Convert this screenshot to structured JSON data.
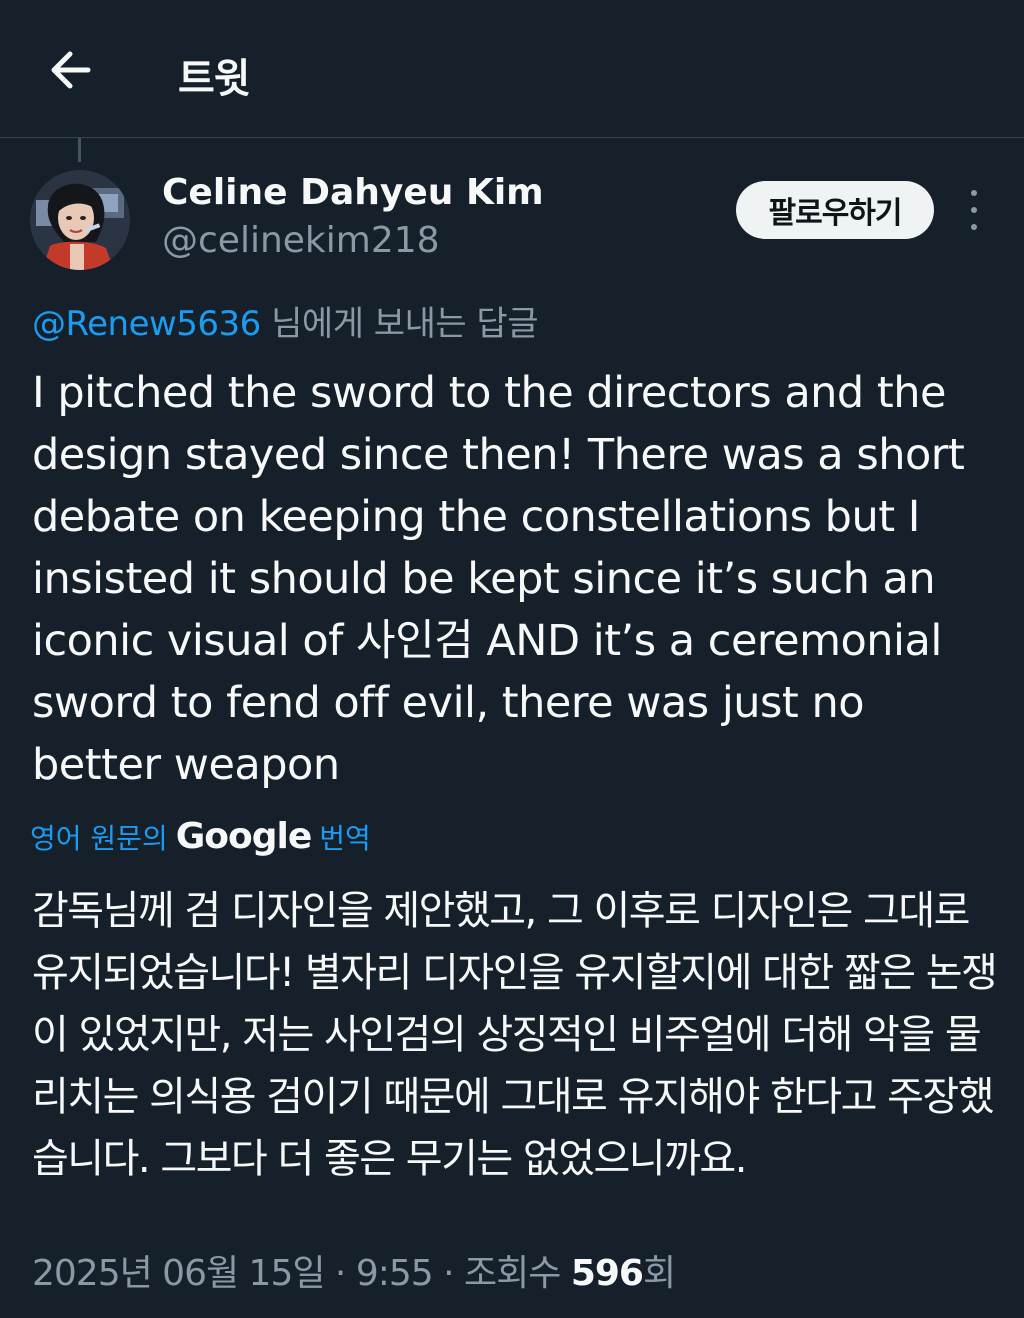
{
  "header": {
    "title": "트윗",
    "back_icon": "arrow-left-icon"
  },
  "author": {
    "name": "Celine Dahyeu Kim",
    "handle": "@celinekim218",
    "follow_label": "팔로우하기",
    "more_icon": "more-vertical-icon"
  },
  "reply": {
    "handle": "@Renew5636",
    "suffix": " 님에게 보내는 답글"
  },
  "tweet": {
    "text": "I pitched the sword to the directors and the design stayed since then! There was a short debate on keeping the constellations but I insisted it should be kept since it’s such an iconic visual of 사인검 AND it’s a ceremonial sword to fend off evil, there was just no better weapon"
  },
  "translation": {
    "from_label": "영어 원문의",
    "provider": "Google",
    "action_label": "번역",
    "text": "감독님께 검 디자인을 제안했고, 그 이후로 디자인은 그대로 유지되었습니다! 별자리 디자인을 유지할지에 대한 짧은 논쟁이 있었지만, 저는 사인검의 상징적인 비주얼에 더해 악을 물리치는 의식용 검이기 때문에 그대로 유지해야 한다고 주장했습니다. 그보다 더 좋은 무기는 없었으니까요."
  },
  "meta": {
    "date": "2025년 06월 15일",
    "sep1": " · ",
    "time": "9:55",
    "sep2": " · ",
    "views_label": "조회수 ",
    "views_count": "596",
    "views_suffix": "회"
  },
  "colors": {
    "background": "#15202b",
    "accent": "#1d9bf0",
    "secondary_text": "#8b98a5"
  }
}
